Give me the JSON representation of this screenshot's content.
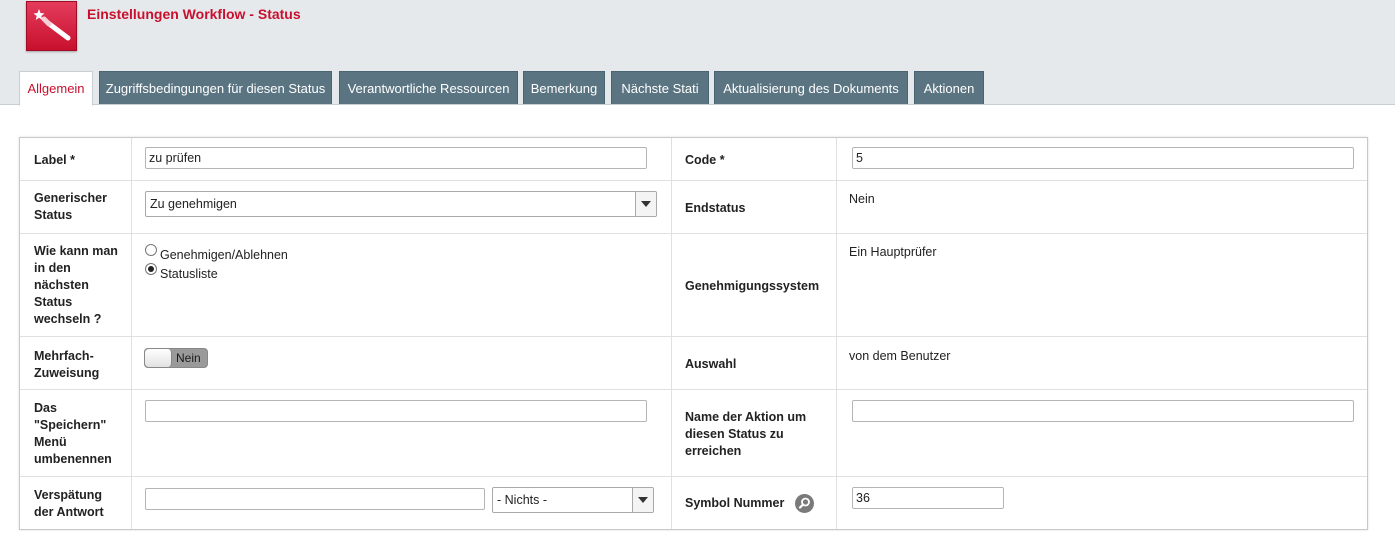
{
  "page": {
    "title": "Einstellungen Workflow - Status",
    "logo_icon": "magic-wand-icon",
    "accent_color": "#c8102e",
    "tab_color": "#5a7482"
  },
  "tabs": [
    {
      "label": "Allgemein",
      "active": true
    },
    {
      "label": "Zugriffsbedingungen für diesen Status",
      "active": false
    },
    {
      "label": "Verantwortliche Ressourcen",
      "active": false
    },
    {
      "label": "Bemerkung",
      "active": false
    },
    {
      "label": "Nächste Stati",
      "active": false
    },
    {
      "label": "Aktualisierung des Dokuments",
      "active": false
    },
    {
      "label": "Aktionen",
      "active": false
    }
  ],
  "form": {
    "label": {
      "label": "Label *",
      "value": "zu prüfen"
    },
    "code": {
      "label": "Code *",
      "value": "5"
    },
    "generic_status": {
      "label": "Generischer Status",
      "value": "Zu genehmigen"
    },
    "end_status": {
      "label": "Endstatus",
      "value": "Nein"
    },
    "switch_mode": {
      "label": "Wie kann man in den nächsten Status wechseln ?",
      "options": [
        "Genehmigen/Ablehnen",
        "Statusliste"
      ],
      "selected": "Statusliste"
    },
    "approval_system": {
      "label": "Genehmigungssystem",
      "value": "Ein Hauptprüfer"
    },
    "multi_assign": {
      "label": "Mehrfach-Zuweisung",
      "value": "Nein"
    },
    "selection": {
      "label": "Auswahl",
      "value": "von dem Benutzer"
    },
    "rename_save": {
      "label": "Das \"Speichern\" Menü umbenennen",
      "value": ""
    },
    "action_name": {
      "label": "Name der Aktion um diesen Status zu erreichen",
      "value": ""
    },
    "delay": {
      "label": "Verspätung der Antwort",
      "value": "",
      "unit": "- Nichts -"
    },
    "symbol": {
      "label": "Symbol Nummer",
      "value": "36",
      "icon": "magnifier-icon"
    }
  }
}
